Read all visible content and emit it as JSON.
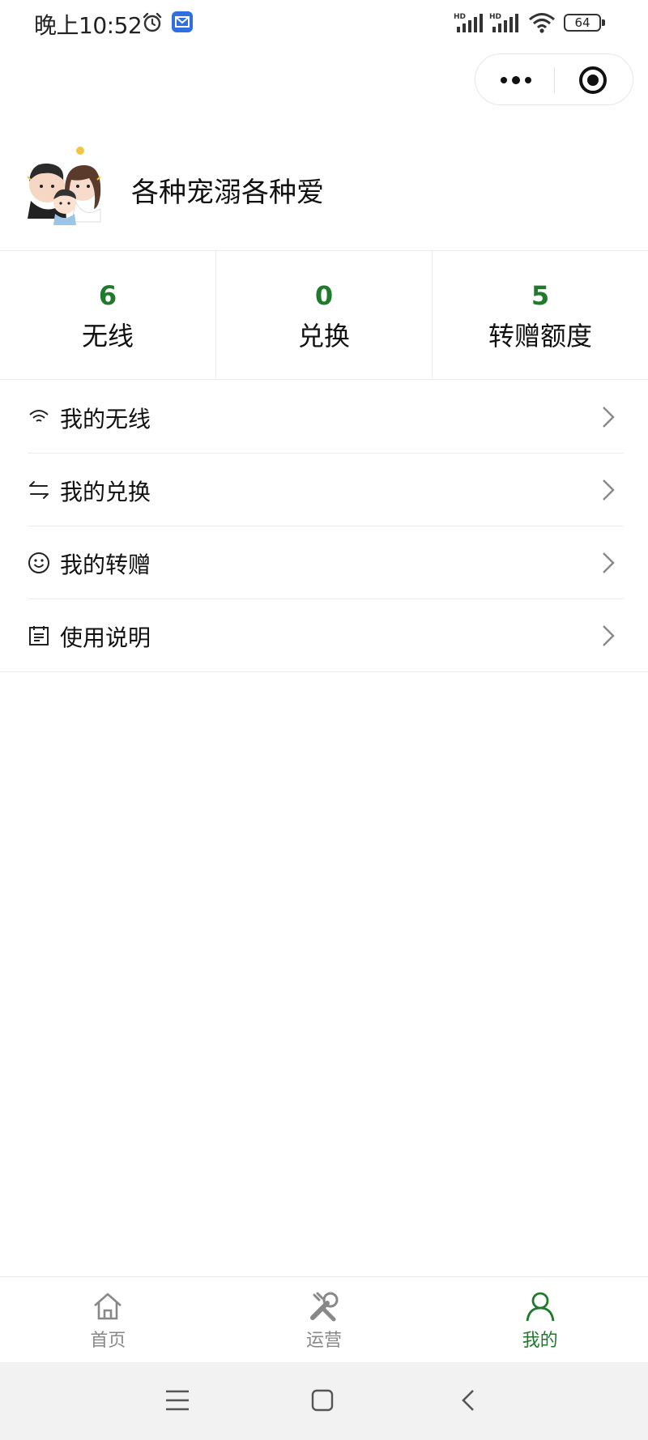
{
  "status_bar": {
    "time": "晚上10:52",
    "battery": "64",
    "icons": [
      "alarm-icon",
      "mail-app-icon",
      "hd-signal-icon",
      "hd-signal-icon",
      "wifi-icon",
      "battery-icon"
    ]
  },
  "capsule": {
    "icons": [
      "more-icon",
      "close-target-icon"
    ]
  },
  "profile": {
    "name": "各种宠溺各种爱"
  },
  "stats": [
    {
      "value": "6",
      "label": "无线"
    },
    {
      "value": "0",
      "label": "兑换"
    },
    {
      "value": "5",
      "label": "转赠额度"
    }
  ],
  "menu": [
    {
      "label": "我的无线",
      "icon": "wifi-icon"
    },
    {
      "label": "我的兑换",
      "icon": "swap-icon"
    },
    {
      "label": "我的转赠",
      "icon": "smile-icon"
    },
    {
      "label": "使用说明",
      "icon": "document-icon"
    }
  ],
  "tabbar": [
    {
      "label": "首页",
      "icon": "home-icon",
      "active": false
    },
    {
      "label": "运营",
      "icon": "tools-icon",
      "active": false
    },
    {
      "label": "我的",
      "icon": "user-icon",
      "active": true
    }
  ],
  "colors": {
    "accent": "#1f7a2b",
    "inactive": "#888888",
    "divider": "#ececec"
  }
}
